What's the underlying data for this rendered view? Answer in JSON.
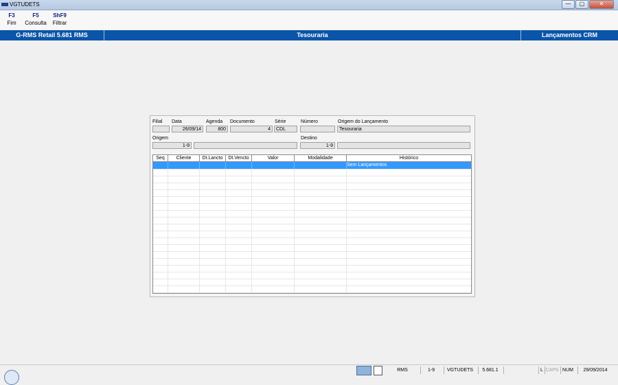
{
  "window": {
    "title": "VGTUDETS",
    "buttons": [
      "—",
      "▢",
      "✕"
    ]
  },
  "toolbar": {
    "keys": [
      {
        "key": "F3",
        "label": "Fim"
      },
      {
        "key": "F5",
        "label": "Consulta"
      },
      {
        "key": "ShF9",
        "label": "Filtrar"
      }
    ]
  },
  "header": {
    "app": "G-RMS Retail 5.681 RMS",
    "module": "Tesouraria",
    "screen": "Lançamentos CRM"
  },
  "form": {
    "filial_label": "Filial",
    "filial_value": "",
    "data_label": "Data",
    "data_value": "26/09/14",
    "agenda_label": "Agenda",
    "agenda_value": "800",
    "documento_label": "Documento",
    "documento_value": "4",
    "serie_label": "Série",
    "serie_value": "CDL",
    "numero_label": "Número",
    "numero_value": "",
    "origem_lanc_label": "Origem do Lançamento",
    "origem_lanc_value": "Tesouraria",
    "origem_label": "Origem",
    "origem_code": "1-9",
    "origem_desc": "",
    "destino_label": "Destino",
    "destino_code": "1-9",
    "destino_desc": ""
  },
  "grid": {
    "columns": [
      "Seq",
      "Cliente",
      "Dt.Lancto",
      "Dt.Vencto",
      "Valor",
      "Modalidade",
      "Histórico"
    ],
    "rows": [
      {
        "seq": "",
        "cliente": "",
        "dt_lancto": "",
        "dt_vencto": "",
        "valor": "",
        "modalidade": "",
        "historico": "Sem Lançamentos"
      }
    ]
  },
  "status": {
    "items": [
      "RMS",
      "1-9",
      "VGTUDETS",
      "5.681.1",
      "",
      "L",
      "CAPS",
      "NUM",
      "29/09/2014"
    ]
  }
}
